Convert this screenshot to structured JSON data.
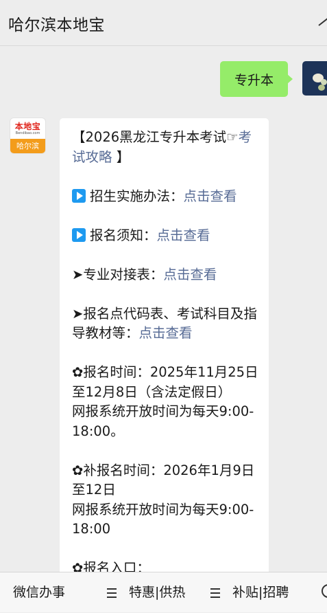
{
  "header": {
    "title": "哈尔滨本地宝"
  },
  "chat": {
    "outgoing": {
      "text": "专升本"
    },
    "sender": {
      "logo_top": "本地宝",
      "logo_url": "Bendibao.com",
      "logo_city": "哈尔滨"
    },
    "incoming": {
      "title_line1": "【2026黑龙江专升本考试☞",
      "title_link": "考试攻略",
      "title_end": " 】",
      "item1_label": "招生实施办法：",
      "item2_label": "报名须知：",
      "item3_label": "➤专业对接表：",
      "item4_label": "➤报名点代码表、考试科目及指导教材等：",
      "link_text": "点击查看",
      "reg_time": "✿报名时间：2025年11月25日至12月8日（含法定假日）",
      "reg_time_sys": "网报系统开放时间为每天9:00-18:00。",
      "supp_time": "✿补报名时间：2026年1月9日至12日",
      "supp_time_sys": "网报系统开放时间为每天9:00-18:00",
      "entry_label": "✿报名入口："
    }
  },
  "menu": {
    "items": [
      "微信办事",
      "特惠|供热",
      "补贴|招聘"
    ]
  }
}
